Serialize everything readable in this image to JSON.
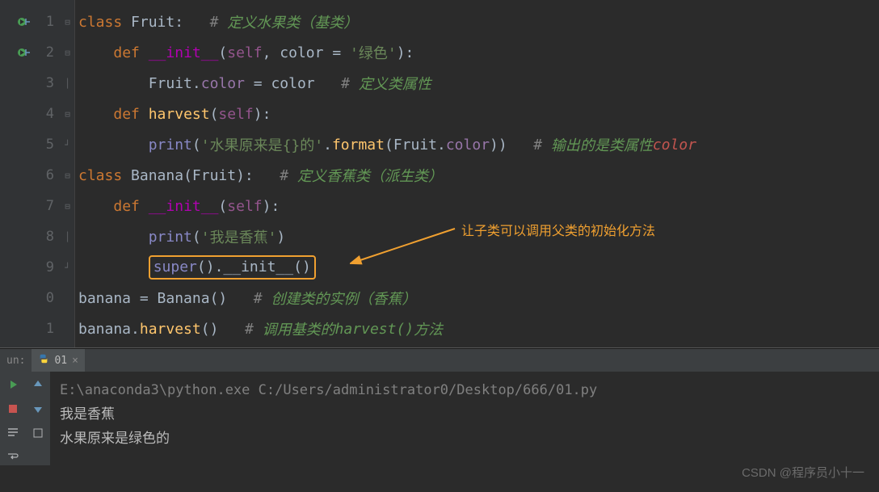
{
  "gutter": {
    "lines": [
      "1",
      "2",
      "3",
      "4",
      "5",
      "6",
      "7",
      "8",
      "9",
      "0",
      "1"
    ]
  },
  "code": {
    "l1": {
      "kw": "class ",
      "name": "Fruit",
      "colon": ":",
      "sp": "   ",
      "hash": "# ",
      "cmt": "定义水果类（基类）"
    },
    "l2": {
      "indent": "    ",
      "kw": "def ",
      "fn": "__init__",
      "p1": "(",
      "self": "self",
      "comma": ", color = ",
      "arg": "'绿色'",
      "p2": "):"
    },
    "l3": {
      "indent": "        ",
      "obj": "Fruit",
      "dot": ".",
      "attr": "color",
      "eq": " = ",
      "rhs": "color",
      "sp": "   ",
      "hash": "# ",
      "cmt": "定义类属性"
    },
    "l4": {
      "indent": "    ",
      "kw": "def ",
      "fn": "harvest",
      "p1": "(",
      "self": "self",
      "p2": "):"
    },
    "l5": {
      "indent": "        ",
      "print": "print",
      "p1": "(",
      "str": "'水果原来是{}的'",
      "dot": ".",
      "fmt": "format",
      "p2": "(",
      "obj": "Fruit",
      "dot2": ".",
      "attr": "color",
      "p3": "))",
      "sp": "   ",
      "hash": "# ",
      "cmt": "输出的是类属性",
      "cmt2": "color"
    },
    "l6": {
      "kw": "class ",
      "name": "Banana",
      "p1": "(",
      "base": "Fruit",
      "p2": "):",
      "sp": "   ",
      "hash": "# ",
      "cmt": "定义香蕉类（派生类）"
    },
    "l7": {
      "indent": "    ",
      "kw": "def ",
      "fn": "__init__",
      "p1": "(",
      "self": "self",
      "p2": "):"
    },
    "l8": {
      "indent": "        ",
      "print": "print",
      "p1": "(",
      "str": "'我是香蕉'",
      "p2": ")"
    },
    "l9": {
      "indent": "        ",
      "super": "super",
      "p1": "().",
      "init": "__init__",
      "p2": "()"
    },
    "l10": {
      "var": "banana",
      "eq": " = ",
      "cls": "Banana",
      "call": "()",
      "sp": "   ",
      "hash": "# ",
      "cmt": "创建类的实例（香蕉）"
    },
    "l11": {
      "var": "banana",
      "dot": ".",
      "fn": "harvest",
      "call": "()",
      "sp": "   ",
      "hash": "# ",
      "cmt": "调用基类的",
      "cmt2": "harvest()",
      "cmt3": "方法"
    }
  },
  "annotation": {
    "text": "让子类可以调用父类的初始化方法"
  },
  "run": {
    "label": "un:",
    "tab_name": "01",
    "cmd": "E:\\anaconda3\\python.exe C:/Users/administrator0/Desktop/666/01.py",
    "out1": "我是香蕉",
    "out2": "水果原来是绿色的"
  },
  "watermark": "CSDN @程序员小十一"
}
